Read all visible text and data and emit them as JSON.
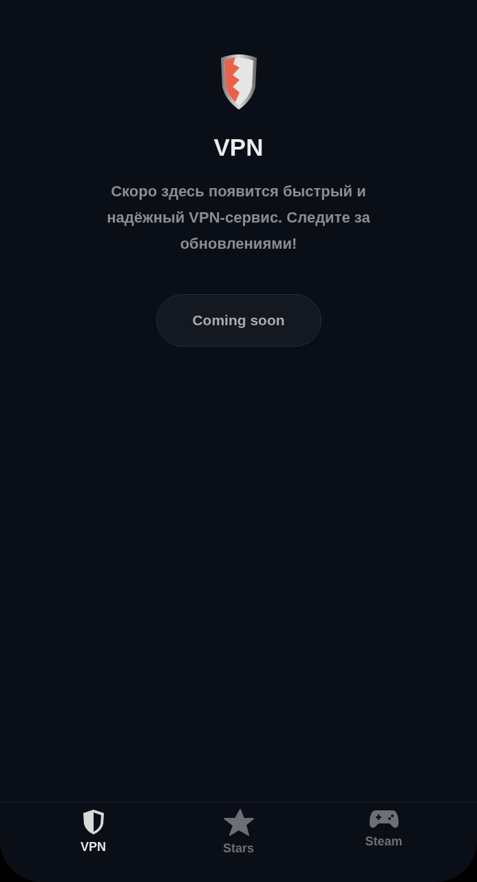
{
  "title": "VPN",
  "description": "Скоро здесь появится быстрый и надёжный VPN-сервис. Следите за обновлениями!",
  "button": {
    "label": "Coming soon",
    "disabled": true
  },
  "tabs": [
    {
      "label": "VPN",
      "kind": "shield",
      "selected": true
    },
    {
      "label": "Stars",
      "kind": "star",
      "selected": false
    },
    {
      "label": "Steam",
      "kind": "gamepad",
      "selected": false
    }
  ]
}
